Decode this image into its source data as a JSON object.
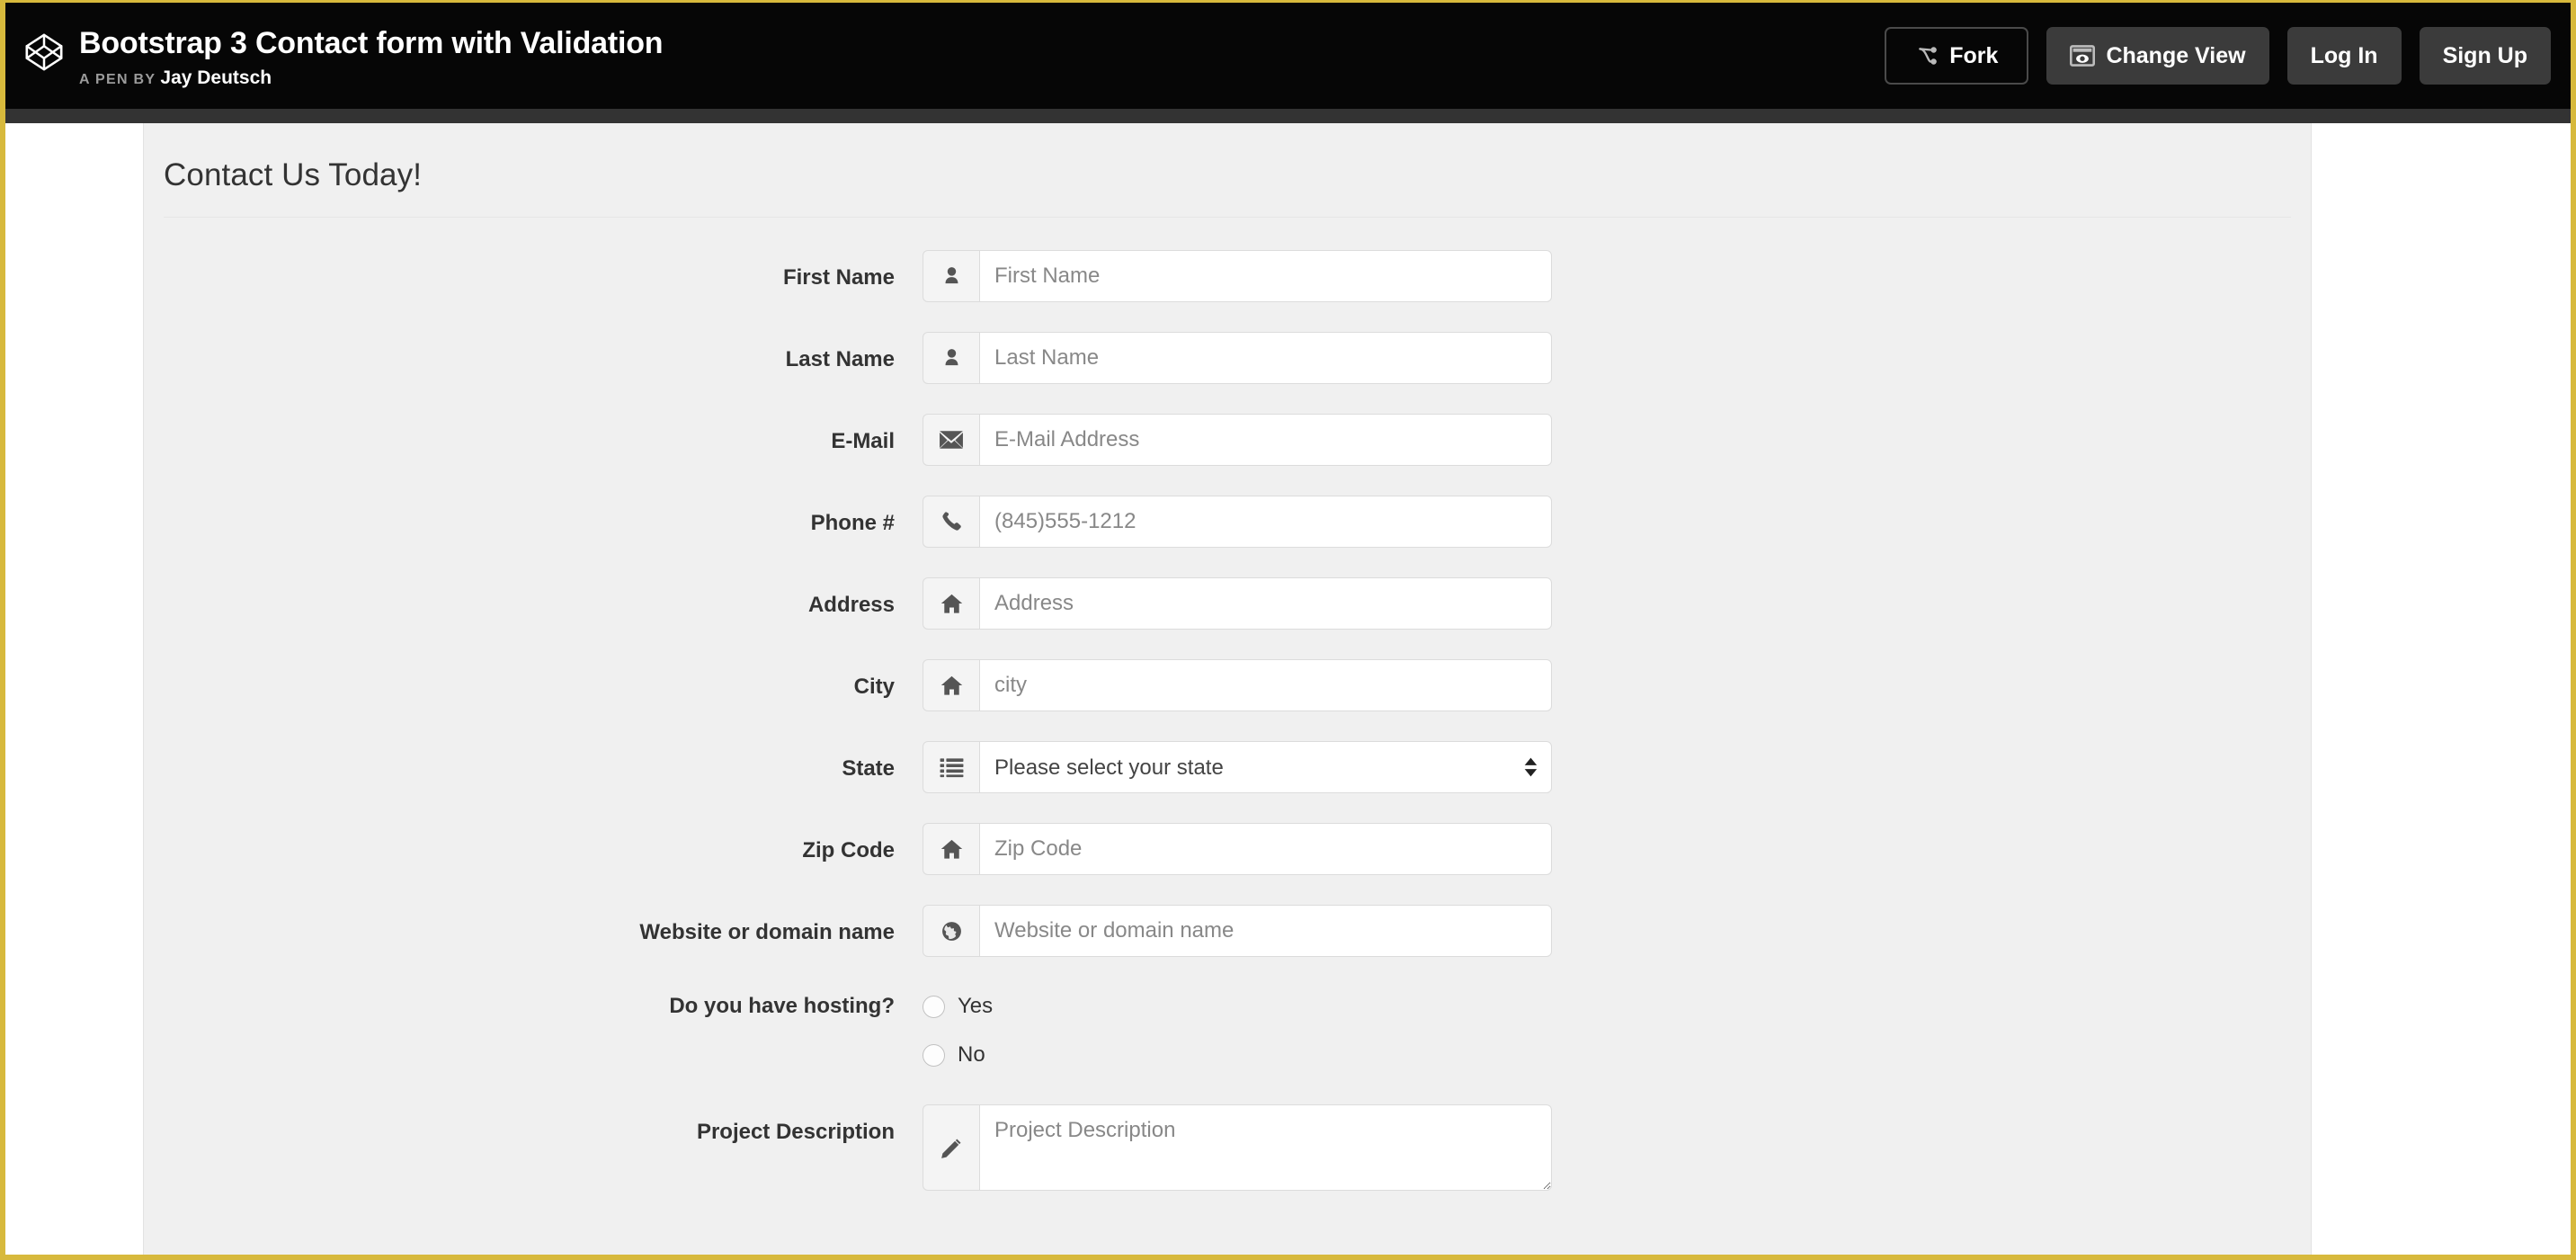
{
  "topbar": {
    "logo_icon": "codepen-logo-icon",
    "pen_title": "Bootstrap 3 Contact form with Validation",
    "byline_prefix": "A PEN BY",
    "author": "Jay Deutsch",
    "actions": [
      {
        "label": "Fork",
        "icon": "git-fork-icon",
        "style": "outline"
      },
      {
        "label": "Change View",
        "icon": "eye-in-box-icon",
        "style": "solid"
      },
      {
        "label": "Log In",
        "icon": "",
        "style": "solid"
      },
      {
        "label": "Sign Up",
        "icon": "",
        "style": "solid"
      }
    ]
  },
  "panel": {
    "title": "Contact Us Today!"
  },
  "form": {
    "fields": [
      {
        "label": "First Name",
        "icon": "user-icon",
        "placeholder": "First Name",
        "value": "",
        "type": "text"
      },
      {
        "label": "Last Name",
        "icon": "user-icon",
        "placeholder": "Last Name",
        "value": "",
        "type": "text"
      },
      {
        "label": "E-Mail",
        "icon": "envelope-icon",
        "placeholder": "E-Mail Address",
        "value": "",
        "type": "text"
      },
      {
        "label": "Phone #",
        "icon": "phone-icon",
        "placeholder": "(845)555-1212",
        "value": "",
        "type": "text"
      },
      {
        "label": "Address",
        "icon": "home-icon",
        "placeholder": "Address",
        "value": "",
        "type": "text"
      },
      {
        "label": "City",
        "icon": "home-icon",
        "placeholder": "city",
        "value": "",
        "type": "text"
      },
      {
        "label": "State",
        "icon": "list-icon",
        "placeholder": "",
        "value": "Please select your state",
        "type": "select"
      },
      {
        "label": "Zip Code",
        "icon": "home-icon",
        "placeholder": "Zip Code",
        "value": "",
        "type": "text"
      },
      {
        "label": "Website or domain name",
        "icon": "globe-icon",
        "placeholder": "Website or domain name",
        "value": "",
        "type": "text"
      }
    ],
    "hosting": {
      "label": "Do you have hosting?",
      "options": [
        {
          "label": "Yes",
          "checked": false
        },
        {
          "label": "No",
          "checked": false
        }
      ]
    },
    "description": {
      "label": "Project Description",
      "icon": "pencil-icon",
      "placeholder": "Project Description",
      "value": ""
    },
    "state_select": {
      "selected": "Please select your state",
      "options": [
        "Please select your state"
      ]
    }
  },
  "colors": {
    "frame_yellow": "#d7b93c",
    "topbar_black": "#060606",
    "substrip_gray": "#333333",
    "panel_gray": "#f0f0f0",
    "addon_gray": "#f4f4f4",
    "border_gray": "#dcdcdc",
    "text_dark": "#333333",
    "placeholder_gray": "#888888"
  }
}
